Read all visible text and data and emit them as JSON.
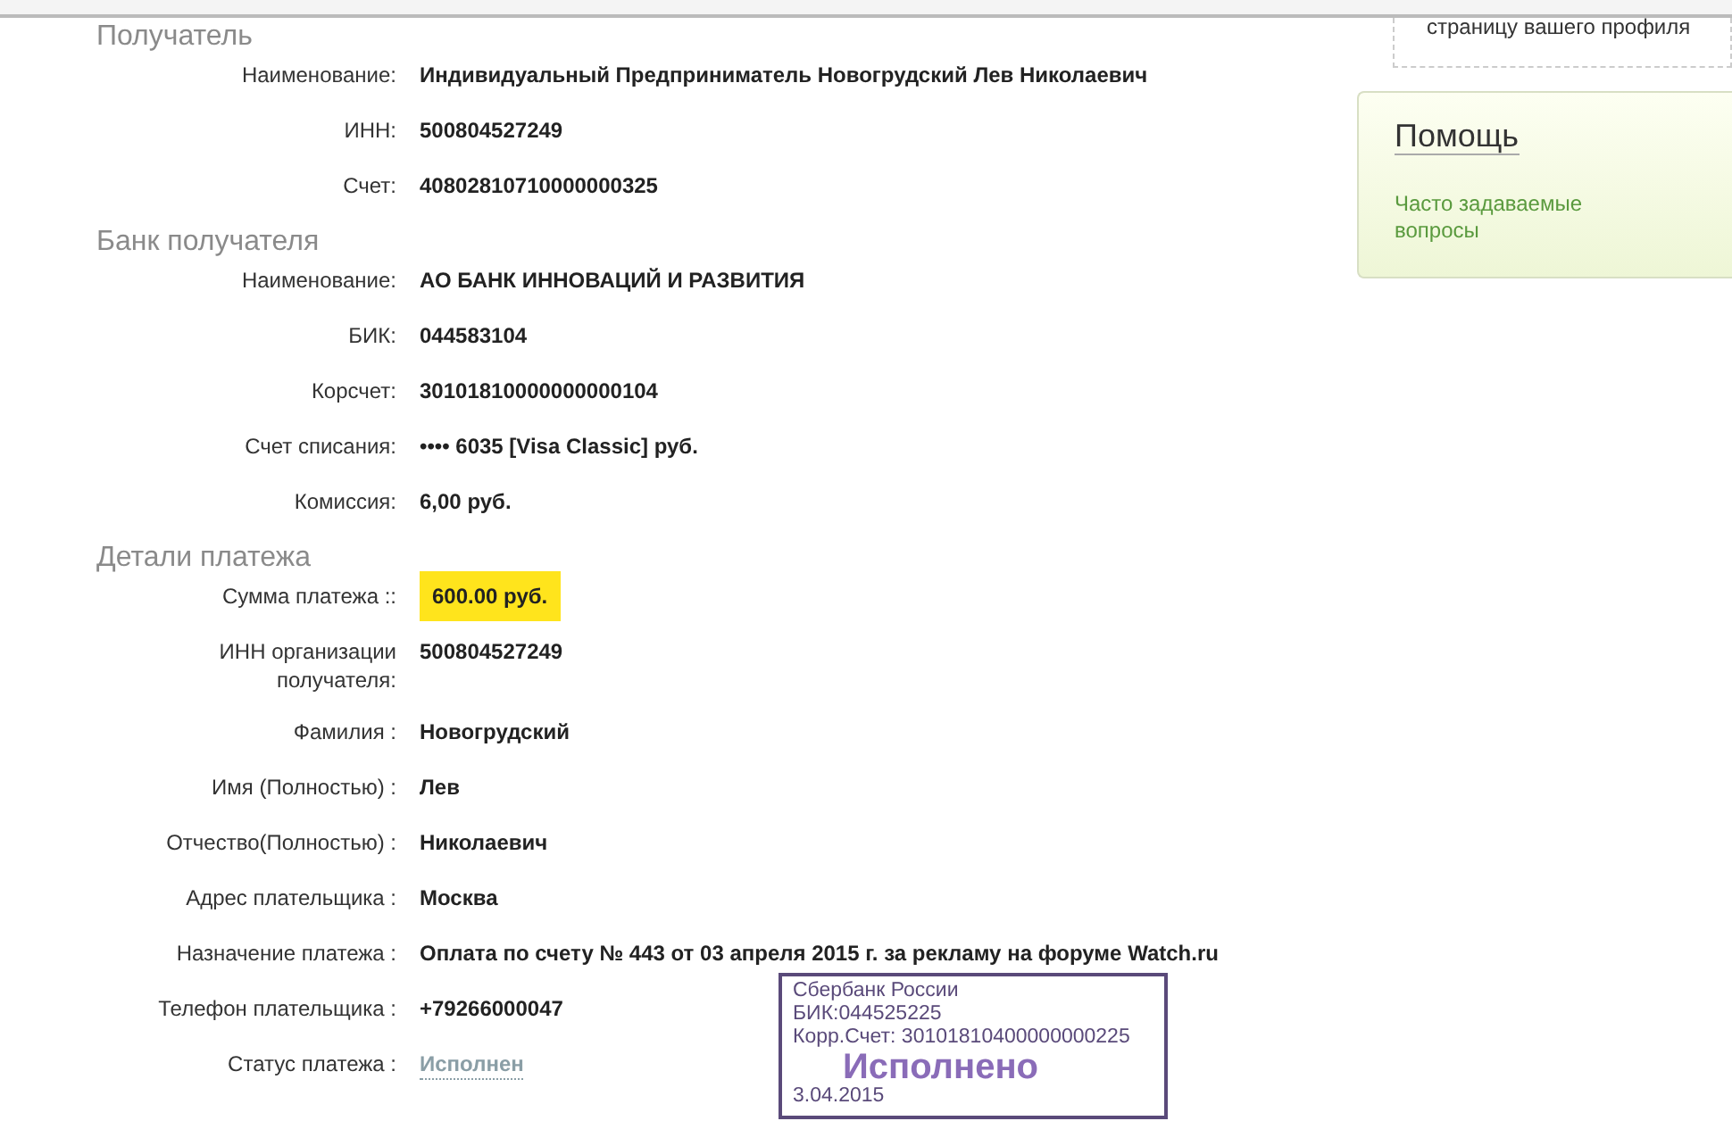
{
  "sections": [
    {
      "title": "Получатель",
      "rows": [
        {
          "label": "Наименование:",
          "value": "Индивидуальный Предприниматель Новогрудский Лев Николаевич",
          "kind": "text"
        },
        {
          "label": "ИНН:",
          "value": "500804527249",
          "kind": "text"
        },
        {
          "label": "Счет:",
          "value": "40802810710000000325",
          "kind": "text"
        }
      ]
    },
    {
      "title": "Банк получателя",
      "rows": [
        {
          "label": "Наименование:",
          "value": "АО БАНК ИННОВАЦИЙ И РАЗВИТИЯ",
          "kind": "text"
        },
        {
          "label": "БИК:",
          "value": "044583104",
          "kind": "text"
        },
        {
          "label": "Корсчет:",
          "value": "30101810000000000104",
          "kind": "text"
        },
        {
          "label": "Счет списания:",
          "value": "•••• 6035  [Visa Classic]  руб.",
          "kind": "text"
        },
        {
          "label": "Комиссия:",
          "value": "6,00 руб.",
          "kind": "text"
        }
      ]
    },
    {
      "title": "Детали платежа",
      "rows": [
        {
          "label": "Сумма платежа ::",
          "value": "600.00 руб.",
          "kind": "highlight"
        },
        {
          "label": "ИНН организации получателя:",
          "value": "500804527249",
          "kind": "text"
        },
        {
          "label": "Фамилия :",
          "value": "Новогрудский",
          "kind": "text"
        },
        {
          "label": "Имя (Полностью) :",
          "value": "Лев",
          "kind": "text"
        },
        {
          "label": "Отчество(Полностью) :",
          "value": "Николаевич",
          "kind": "text"
        },
        {
          "label": "Адрес плательщика :",
          "value": "Москва",
          "kind": "text"
        },
        {
          "label": "Назначение платежа :",
          "value": "Оплата по счету № 443 от 03 апреля 2015 г. за рекламу на форуме Watch.ru",
          "kind": "text"
        },
        {
          "label": "Телефон плательщика :",
          "value": "+79266000047",
          "kind": "text"
        },
        {
          "label": "Статус платежа :",
          "value": "Исполнен",
          "kind": "status"
        }
      ]
    }
  ],
  "stamp": {
    "bank": "Сбербанк России",
    "bik": "БИК:044525225",
    "account": "Корр.Счет: 30101810400000000225",
    "status": "Исполнено",
    "date": "3.04.2015"
  },
  "sidebar": {
    "profile_note": "страницу вашего профиля",
    "help": {
      "title": "Помощь",
      "link": "Часто задаваемые вопросы"
    }
  }
}
